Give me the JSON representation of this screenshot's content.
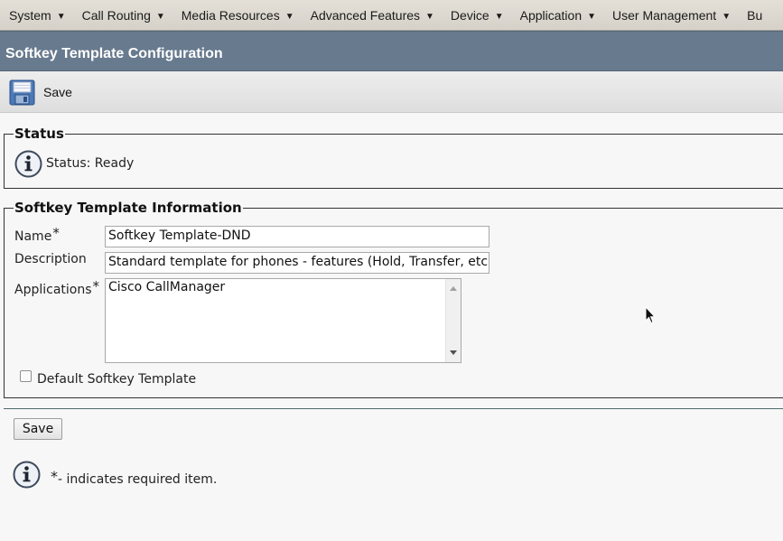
{
  "menu": [
    {
      "label": "System"
    },
    {
      "label": "Call Routing"
    },
    {
      "label": "Media Resources"
    },
    {
      "label": "Advanced Features"
    },
    {
      "label": "Device"
    },
    {
      "label": "Application"
    },
    {
      "label": "User Management"
    },
    {
      "label": "Bu"
    }
  ],
  "page": {
    "title": "Softkey Template Configuration"
  },
  "toolbar": {
    "save_label": "Save",
    "save_icon": "floppy-disk-icon"
  },
  "status": {
    "legend": "Status",
    "text": "Status: Ready",
    "icon": "info-icon"
  },
  "info": {
    "legend": "Softkey Template Information",
    "name_label": "Name",
    "name_value": "Softkey Template-DND",
    "description_label": "Description",
    "description_value": "Standard template for phones - features (Hold, Transfer, etc",
    "applications_label": "Applications",
    "applications_options": [
      "Cisco CallManager"
    ],
    "default_label": "Default Softkey Template",
    "default_checked": false,
    "required_mark": "*"
  },
  "footer": {
    "save_label": "Save",
    "required_star": "*",
    "required_text": "- indicates required item."
  },
  "colors": {
    "header_band": "#687a8e",
    "menu_bar": "#dcd8d0",
    "page_background": "#f7f7f7"
  }
}
